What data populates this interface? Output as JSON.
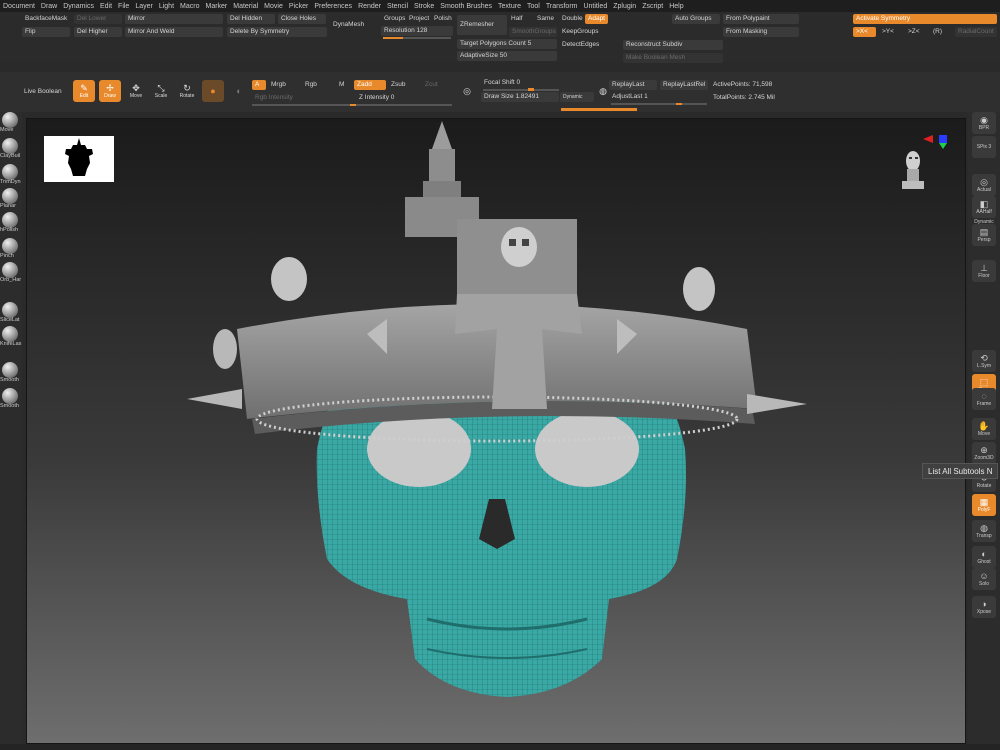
{
  "menu": [
    "Document",
    "Draw",
    "Dynamics",
    "Edit",
    "File",
    "Layer",
    "Light",
    "Macro",
    "Marker",
    "Material",
    "Movie",
    "Picker",
    "Preferences",
    "Render",
    "Stencil",
    "Stroke",
    "Smooth Brushes",
    "Texture",
    "Tool",
    "Transform",
    "Untitled",
    "Zplugin",
    "Zscript",
    "Help"
  ],
  "top": {
    "backface_mask": "BackfaceMask",
    "del_lower": "Del Lower",
    "mirror": "Mirror",
    "del_hidden": "Del Hidden",
    "close_holes": "Close Holes",
    "flip": "Flip",
    "del_higher": "Del Higher",
    "mirror_weld": "Mirror And Weld",
    "delete_sym": "Delete By Symmetry",
    "dynamesh": "DynaMesh",
    "groups": "Groups",
    "project": "Project",
    "polish": "Polish",
    "resolution_label": "Resolution",
    "resolution_value": "128",
    "zremesher": "ZRemesher",
    "smooth_groups": "SmoothGroups",
    "half": "Half",
    "same": "Same",
    "double": "Double",
    "adapt": "Adapt",
    "keep_groups": "KeepGroups",
    "detect_edges": "DetectEdges",
    "target_poly_label": "Target Polygons Count",
    "target_poly_value": "5",
    "adaptive_label": "AdaptiveSize",
    "adaptive_value": "50",
    "auto_groups": "Auto Groups",
    "from_polypaint": "From Polypaint",
    "from_masking": "From Masking",
    "reconstruct_subdiv": "Reconstruct Subdiv",
    "make_boolean": "Make Boolean Mesh",
    "activate_symmetry": "Activate Symmetry",
    "sym_x": ">X<",
    "sym_y": ">Y<",
    "sym_z": ">Z<",
    "sym_r": "(R)",
    "radial_count": "RadialCount"
  },
  "shelf": {
    "live_boolean": "Live Boolean",
    "edit": "Edit",
    "draw": "Draw",
    "move": "Move",
    "scale": "Scale",
    "rotate": "Rotate",
    "a": "A",
    "mrgb": "Mrgb",
    "rgb": "Rgb",
    "m": "M",
    "zadd": "Zadd",
    "zsub": "Zsub",
    "zcut": "Zcut",
    "rgb_intensity": "Rgb Intensity",
    "z_intensity_label": "Z Intensity",
    "z_intensity_value": "0",
    "focal_shift_label": "Focal Shift",
    "focal_shift_value": "0",
    "draw_size_label": "Draw Size",
    "draw_size_value": "1.82491",
    "dynamic": "Dynamic",
    "replay_last": "ReplayLast",
    "replay_last_rel": "ReplayLastRel",
    "adjust_last_label": "AdjustLast",
    "adjust_last_value": "1",
    "active_points_label": "ActivePoints:",
    "active_points_value": "71,598",
    "total_points_label": "TotalPoints:",
    "total_points_value": "2.745 Mil"
  },
  "left_brushes": [
    "Move",
    "ClayBuil",
    "TrimDyn",
    "Planar",
    "hPolish",
    "Pinch",
    "Orb_Har",
    "SliceLat",
    "KnifeLas",
    "Smooth",
    "Smooth"
  ],
  "right_tools": [
    "BPR",
    "SPix 3",
    "Actual",
    "AAHalf",
    "Persp",
    "Floor",
    "L.Sym",
    "Qxyz",
    "Frame",
    "Move",
    "Zoom3D",
    "Rotate",
    "PolyF",
    "Transp",
    "Ghost",
    "Solo",
    "Xpose"
  ],
  "right_dynamic": "Dynamic",
  "tooltip": "List All Subtools  N",
  "colors": {
    "accent": "#e8892b",
    "mesh": "#3aa8a4",
    "crown": "#8e8e8e"
  }
}
